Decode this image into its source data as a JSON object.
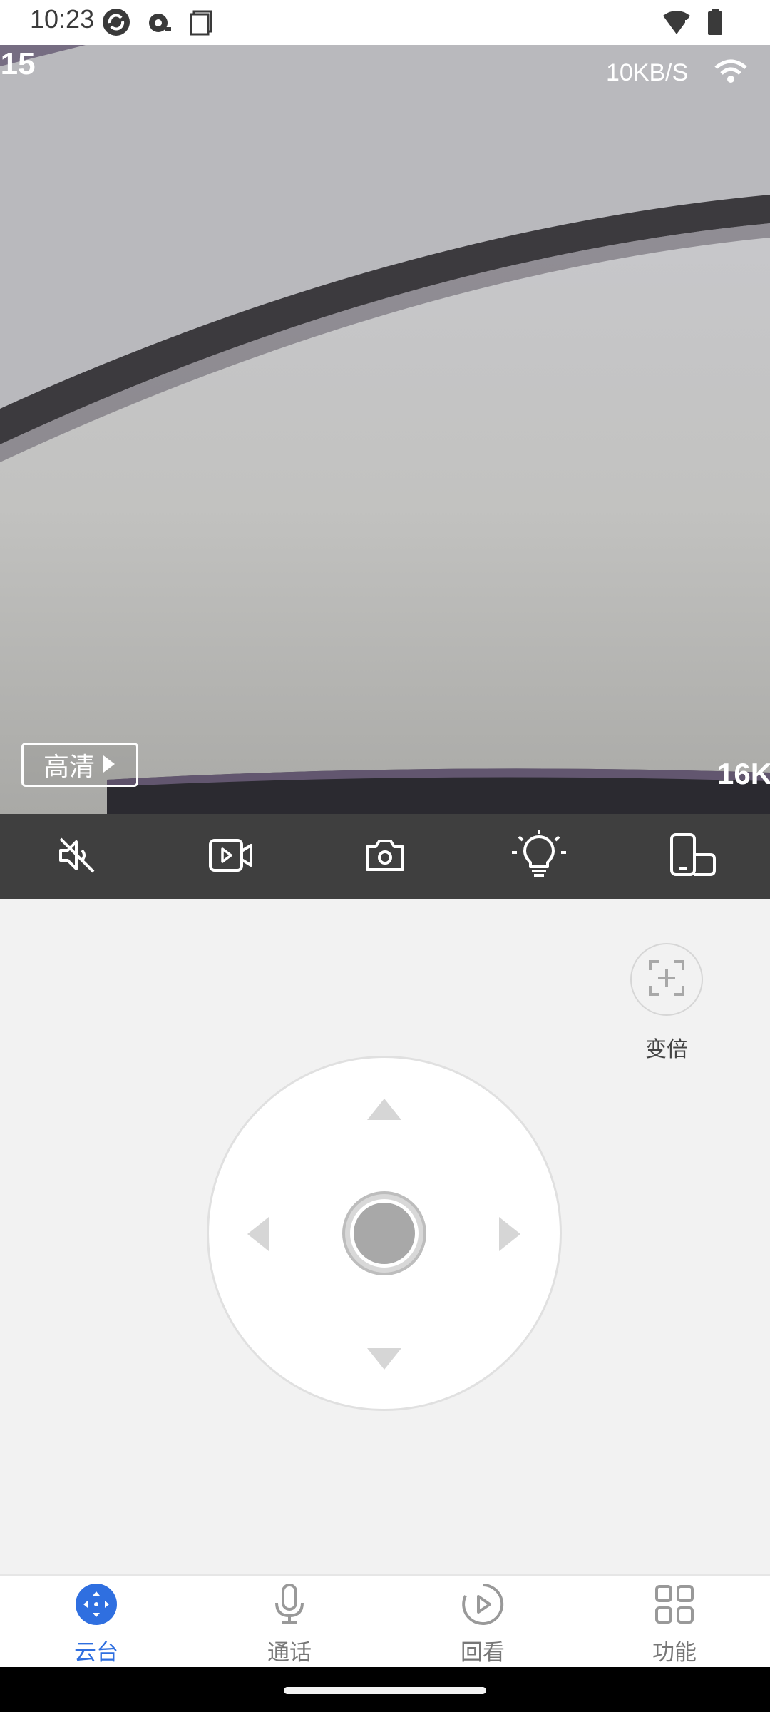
{
  "status_bar": {
    "time": "10:23",
    "icons": [
      "sync-icon",
      "cast-icon",
      "screenshot-icon",
      "wifi-alert-icon",
      "battery-icon"
    ]
  },
  "video": {
    "timestamp": ":15",
    "speed": "10KB/S",
    "quality_label": "高清",
    "bitrate": "16K"
  },
  "toolbar": {
    "items": [
      "mute-icon",
      "record-video-icon",
      "camera-snapshot-icon",
      "light-bulb-icon",
      "rotate-screen-icon"
    ]
  },
  "zoom": {
    "label": "变倍"
  },
  "ptz": {
    "directions": [
      "up",
      "down",
      "left",
      "right"
    ]
  },
  "bottom_nav": {
    "items": [
      {
        "label": "云台",
        "icon": "ptz-icon",
        "active": true
      },
      {
        "label": "通话",
        "icon": "microphone-icon",
        "active": false
      },
      {
        "label": "回看",
        "icon": "playback-icon",
        "active": false
      },
      {
        "label": "功能",
        "icon": "grid-icon",
        "active": false
      }
    ]
  },
  "colors": {
    "accent": "#2f6fe0",
    "toolbar_bg": "#3f3f3f",
    "page_bg": "#f2f2f2"
  }
}
